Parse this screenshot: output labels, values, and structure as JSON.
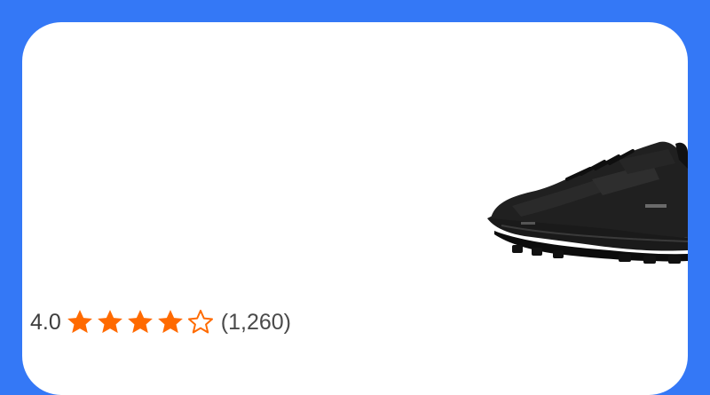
{
  "product": {
    "image_icon": "shoe-image",
    "rating": {
      "value_text": "4.0",
      "value": 4.0,
      "max": 5,
      "review_count_text": "(1,260)",
      "star_color": "#ff6a00",
      "star_icon": "star-icon"
    }
  },
  "colors": {
    "background": "#3478f6",
    "card": "#ffffff"
  }
}
